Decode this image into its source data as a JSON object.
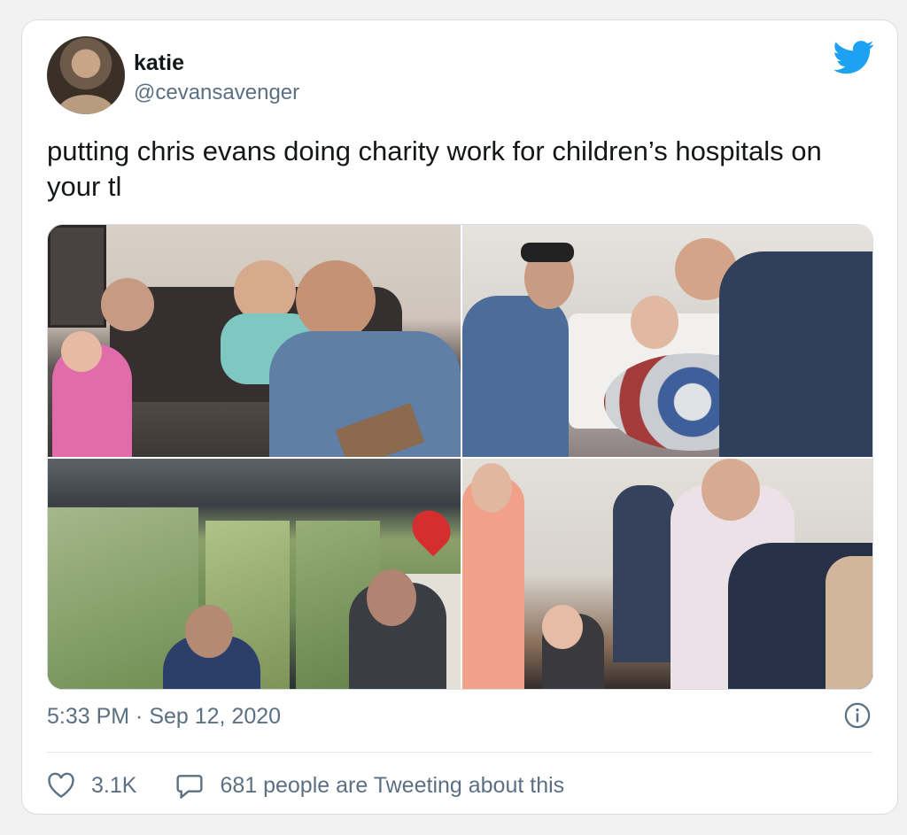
{
  "user": {
    "name": "katie",
    "handle": "@cevansavenger"
  },
  "tweet": {
    "text": "putting chris evans doing charity work for children’s hospitals on your tl",
    "timestamp": "5:33 PM · Sep 12, 2020"
  },
  "stats": {
    "likes": "3.1K",
    "retweet_text": "681 people are Tweeting about this"
  },
  "icons": {
    "brand": "twitter-bird-icon",
    "info": "info-icon",
    "like": "heart-icon",
    "reply": "speech-bubble-icon"
  },
  "colors": {
    "brand": "#1da1f2",
    "secondary_text": "#5b7083"
  }
}
